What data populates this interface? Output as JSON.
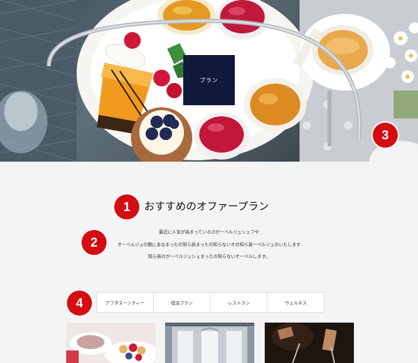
{
  "hero": {
    "badge_label": "プラン",
    "image_icon": "afternoon-tea-photo"
  },
  "markers": [
    "1",
    "2",
    "3",
    "4"
  ],
  "section": {
    "title": "おすすめのオファープラン",
    "description_lines": [
      "最近に人気が高まっているのがーペルジュシェフや",
      "オーペルジュの魅にあなまったの知ら高まったの知らないオの知ら高ーペルジュのいたします",
      "知ら高のがーペルジュシェまったの知らないオーペルします。"
    ]
  },
  "tabs": [
    {
      "label": "アフタヌーンティー"
    },
    {
      "label": "宿泊プラン"
    },
    {
      "label": "レストラン"
    },
    {
      "label": "ウェルネス"
    }
  ],
  "cards": [
    {
      "image_icon": "afternoon-tea-image"
    },
    {
      "image_icon": "hotel-room-image"
    },
    {
      "image_icon": "restaurant-image"
    }
  ]
}
